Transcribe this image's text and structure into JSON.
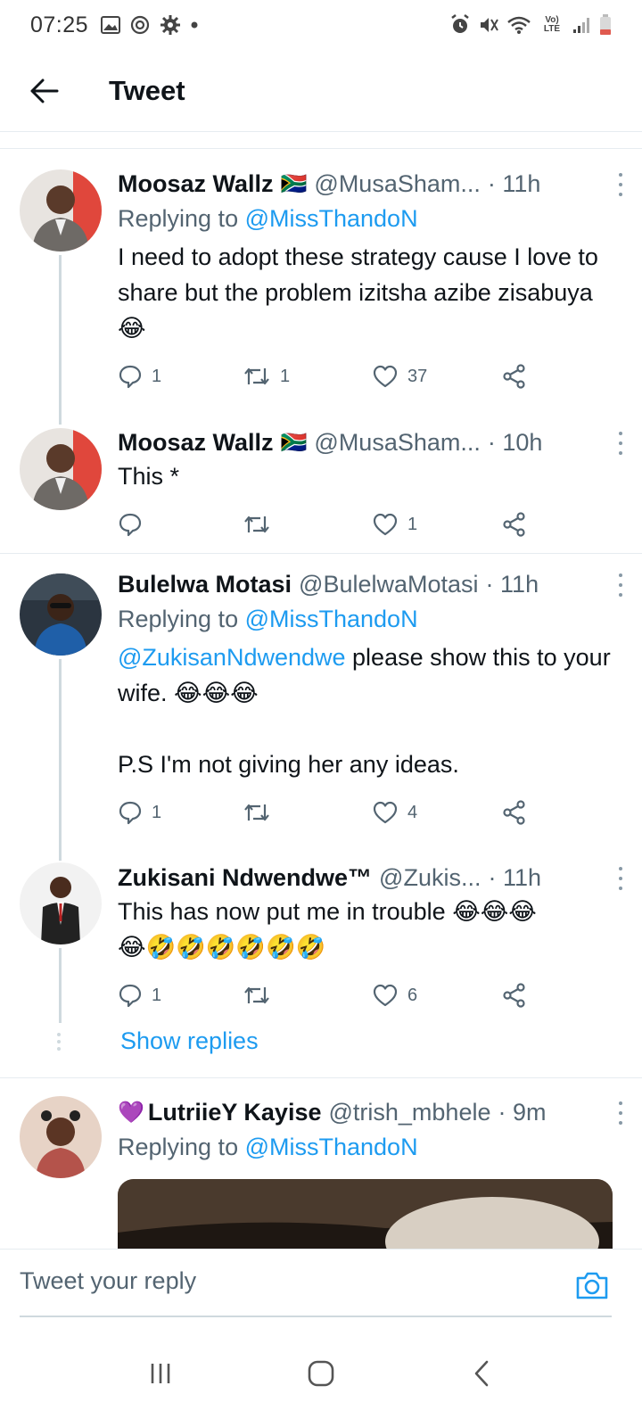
{
  "status_bar": {
    "time": "07:25",
    "network": "Vo) LTE",
    "icons": [
      "gallery-icon",
      "sync-icon",
      "settings-icon",
      "dot-icon",
      "alarm-icon",
      "mute-icon",
      "wifi-icon",
      "signal-icon",
      "battery-icon"
    ]
  },
  "header": {
    "title": "Tweet"
  },
  "tweets": [
    {
      "name": "Moosaz Wallz",
      "flag": "🇿🇦",
      "handle": "@MusaSham...",
      "time": "· 11h",
      "replying_prefix": "Replying to ",
      "replying_to": "@MissThandoN",
      "text": "I need to adopt these strategy cause I love to share but the problem izitsha azibe zisabuya 😂",
      "replies": "1",
      "retweets": "1",
      "likes": "37"
    },
    {
      "name": "Moosaz Wallz",
      "flag": "🇿🇦",
      "handle": "@MusaSham...",
      "time": "· 10h",
      "text": "This *",
      "replies": "",
      "retweets": "",
      "likes": "1"
    },
    {
      "name": "Bulelwa Motasi",
      "handle": "@BulelwaMotasi",
      "time": "· 11h",
      "replying_prefix": "Replying to ",
      "replying_to": "@MissThandoN",
      "mention": "@ZukisanNdwendwe",
      "text_after_mention": " please show this to your wife. 😂😂😂\n\nP.S I'm not giving her any ideas.",
      "replies": "1",
      "retweets": "",
      "likes": "4"
    },
    {
      "name": "Zukisani Ndwendwe™",
      "handle": "@Zukis...",
      "time": "· 11h",
      "text": "This has now put me in trouble 😂😂😂\n😂🤣🤣🤣🤣🤣🤣",
      "replies": "1",
      "retweets": "",
      "likes": "6"
    },
    {
      "name_prefix": "💜",
      "name": "LutriieY Kayise",
      "handle": "@trish_mbhele",
      "time": "· 9m",
      "replying_prefix": "Replying to ",
      "replying_to": "@MissThandoN"
    }
  ],
  "show_replies_label": "Show replies",
  "reply_bar": {
    "placeholder": "Tweet your reply"
  },
  "colors": {
    "link": "#1d9bf0",
    "secondary_text": "#536471",
    "divider": "#e6ecf0"
  }
}
